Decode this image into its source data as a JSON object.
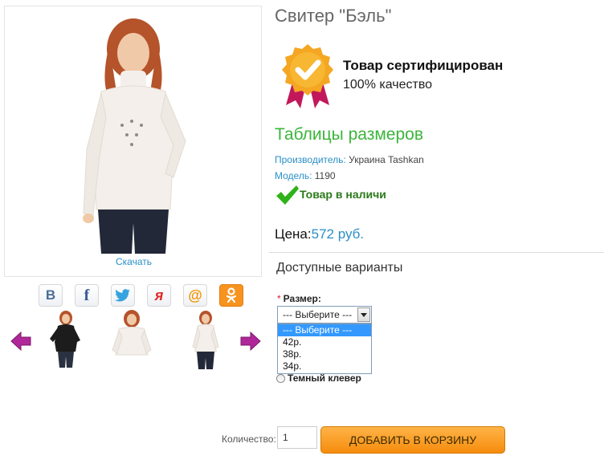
{
  "gallery": {
    "download_label": "Скачать"
  },
  "share_icons": [
    "vk-icon",
    "facebook-icon",
    "twitter-icon",
    "yaru-icon",
    "mailru-icon",
    "odnoklassniki-icon"
  ],
  "share_glyphs": {
    "vk": "В",
    "facebook": "f",
    "yaru": "я",
    "mailru": "@"
  },
  "product": {
    "title": "Свитер \"Бэль\"",
    "cert_title": "Товар сертифицирован",
    "cert_subtitle": "100% качество",
    "size_table_link": "Таблицы размеров",
    "manufacturer_label": "Производитель:",
    "manufacturer_value": "Украина Tashkan",
    "model_label": "Модель:",
    "model_value": "1190",
    "stock_text": "Товар в наличи",
    "price_label": "Цена:",
    "price_value": "572 руб."
  },
  "options": {
    "section_title": "Доступные варианты",
    "required_mark": "*",
    "size_label": "Размер:",
    "size_selected": "--- Выберите ---",
    "size_options": [
      "--- Выберите ---",
      "42р.",
      "38р.",
      "34р."
    ],
    "color_option": "Темный клевер"
  },
  "cart": {
    "qty_label": "Количество:",
    "qty_value": "1",
    "add_button": "ДОБАВИТЬ В КОРЗИНУ"
  },
  "colors": {
    "accent_blue": "#2a8fc7",
    "accent_green": "#3bb53b",
    "button_orange": "#f58c0d"
  }
}
